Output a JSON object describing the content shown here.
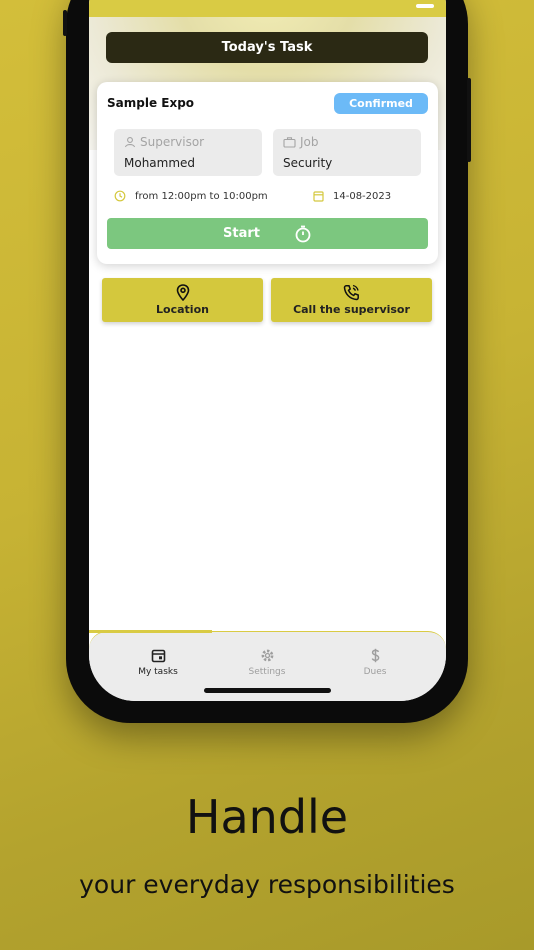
{
  "header": {
    "title": "Today's Task"
  },
  "task": {
    "name": "Sample Expo",
    "status": "Confirmed",
    "supervisor": {
      "label": "Supervisor",
      "value": "Mohammed"
    },
    "job": {
      "label": "Job",
      "value": "Security"
    },
    "time": "from 12:00pm to 10:00pm",
    "date": "14-08-2023",
    "start_label": "Start"
  },
  "actions": {
    "location": "Location",
    "call": "Call the supervisor"
  },
  "nav": {
    "tasks": "My tasks",
    "settings": "Settings",
    "dues": "Dues"
  },
  "promo": {
    "headline": "Handle",
    "subline": "your everyday responsibilities"
  },
  "colors": {
    "accent": "#d9cb44",
    "badge": "#6cbaf7",
    "start": "#7cc77f",
    "title_bar": "#2b2914"
  }
}
